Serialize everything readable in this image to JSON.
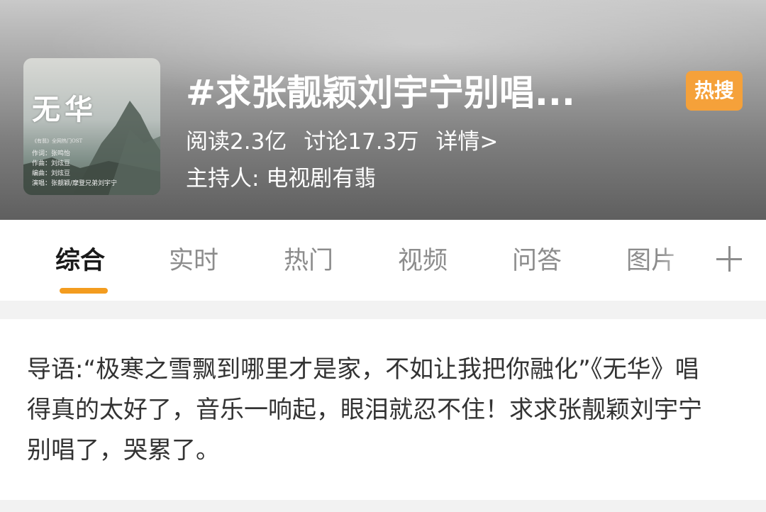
{
  "cover": {
    "title": "无华",
    "subtitle": "《有翡》全网热门OST",
    "credits": [
      "作词：张鸣怡",
      "作曲：刘炫豆",
      "编曲：刘炫豆",
      "演唱：张靓颖/摩登兄弟刘宇宁"
    ]
  },
  "topic": {
    "title": "#求张靓颖刘宇宁别唱...",
    "badge": "热搜",
    "reads": "阅读2.3亿",
    "discussions": "讨论17.3万",
    "details": "详情>",
    "host": "主持人: 电视剧有翡"
  },
  "tabs": [
    "综合",
    "实时",
    "热门",
    "视频",
    "问答",
    "图片"
  ],
  "active_tab": "综合",
  "guide": {
    "text": "导语:“极寒之雪飘到哪里才是家，不如让我把你融化”《无华》唱得真的太好了，音乐一响起，眼泪就忍不住！求求张靓颖刘宇宁别唱了，哭累了。"
  },
  "colors": {
    "accent": "#f39c1f",
    "badge": "#f5a13a",
    "tab_inactive": "#8c8c8c",
    "tab_active": "#1a1a1a"
  }
}
